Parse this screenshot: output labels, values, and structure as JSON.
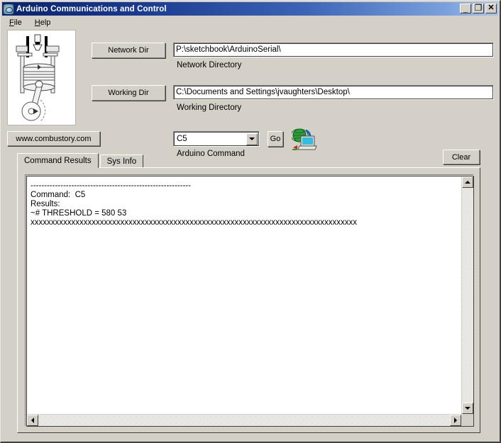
{
  "window": {
    "title": "Arduino Communications and Control",
    "app_icon": "arduino-logo-icon",
    "buttons": {
      "minimize": "_",
      "maximize": "□",
      "close": "✕"
    }
  },
  "menubar": {
    "items": [
      {
        "label": "File",
        "accel": "F"
      },
      {
        "label": "Help",
        "accel": "H"
      }
    ]
  },
  "form": {
    "network_dir_button": "Network Dir",
    "network_dir_value": "P:\\sketchbook\\ArduinoSerial\\",
    "network_dir_caption": "Network Directory",
    "working_dir_button": "Working Dir",
    "working_dir_value": "C:\\Documents and Settings\\jvaughters\\Desktop\\",
    "working_dir_caption": "Working Directory",
    "website_button": "www.combustory.com",
    "command_value": "C5",
    "command_options": [
      "C5"
    ],
    "command_caption": "Arduino Command",
    "go_button": "Go",
    "network_icon": "network-computer-icon",
    "clear_button": "Clear"
  },
  "tabs": [
    {
      "label": "Command Results",
      "active": true
    },
    {
      "label": "Sys Info",
      "active": false
    }
  ],
  "results": {
    "text": "-----------------------------------------------------------\nCommand:  C5\nResults:\n~# THRESHOLD = 580 53\nxxxxxxxxxxxxxxxxxxxxxxxxxxxxxxxxxxxxxxxxxxxxxxxxxxxxxxxxxxxxxxxxxxxxxxxxxxxxxxxx"
  },
  "colors": {
    "face": "#d4d0c8",
    "title_start": "#0a246a",
    "title_end": "#a8c4ea",
    "field_bg": "#ffffff",
    "text": "#000000"
  }
}
